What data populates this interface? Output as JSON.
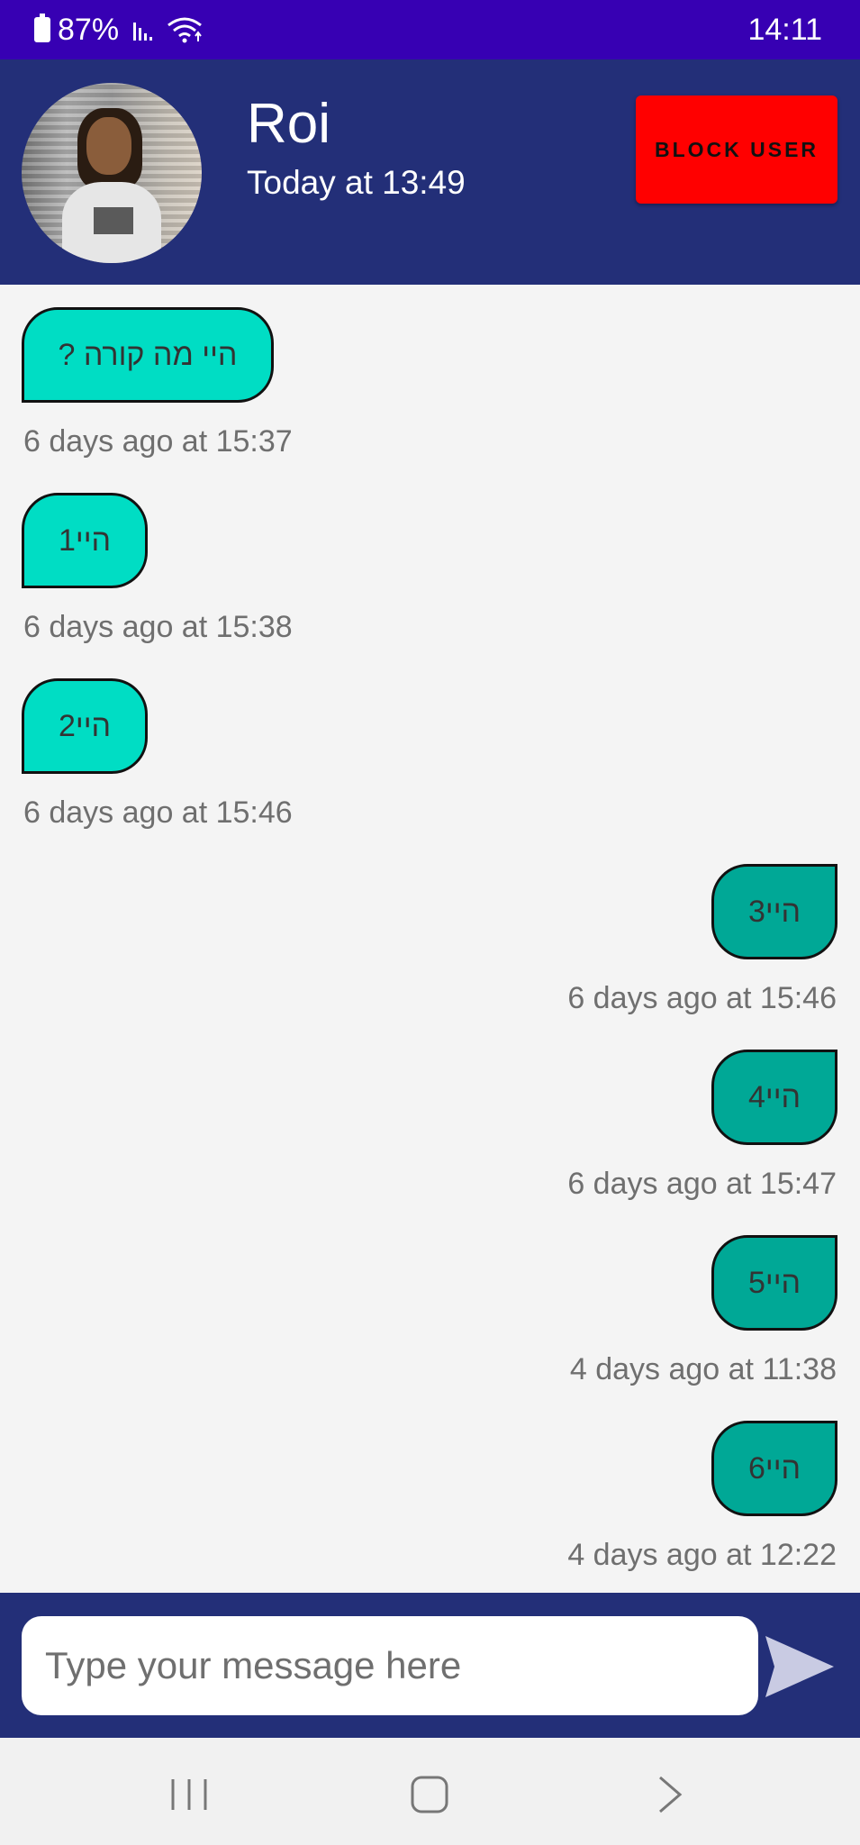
{
  "status_bar": {
    "battery": "87%",
    "time": "14:11",
    "icons": [
      "battery-icon",
      "signal-icon",
      "wifi-icon"
    ]
  },
  "header": {
    "name": "Roi",
    "last_seen": "Today at 13:49",
    "block_label": "BLOCK USER"
  },
  "messages": [
    {
      "text": "היי מה קורה ?",
      "time": "6 days ago at 15:37",
      "direction": "incoming"
    },
    {
      "text": "היי1",
      "time": "6 days ago at 15:38",
      "direction": "incoming"
    },
    {
      "text": "היי2",
      "time": "6 days ago at 15:46",
      "direction": "incoming"
    },
    {
      "text": "היי3",
      "time": "6 days ago at 15:46",
      "direction": "outgoing"
    },
    {
      "text": "היי4",
      "time": "6 days ago at 15:47",
      "direction": "outgoing"
    },
    {
      "text": "היי5",
      "time": "4 days ago at 11:38",
      "direction": "outgoing"
    },
    {
      "text": "היי6",
      "time": "4 days ago at 12:22",
      "direction": "outgoing"
    }
  ],
  "composer": {
    "placeholder": "Type your message here"
  },
  "nav": {
    "icons": [
      "recent-apps-icon",
      "home-icon",
      "back-icon"
    ]
  },
  "colors": {
    "status_bar": "#3700b3",
    "header": "#232f78",
    "block_button": "#ff0000",
    "incoming_bubble": "#00ddc4",
    "outgoing_bubble": "#00a896"
  }
}
